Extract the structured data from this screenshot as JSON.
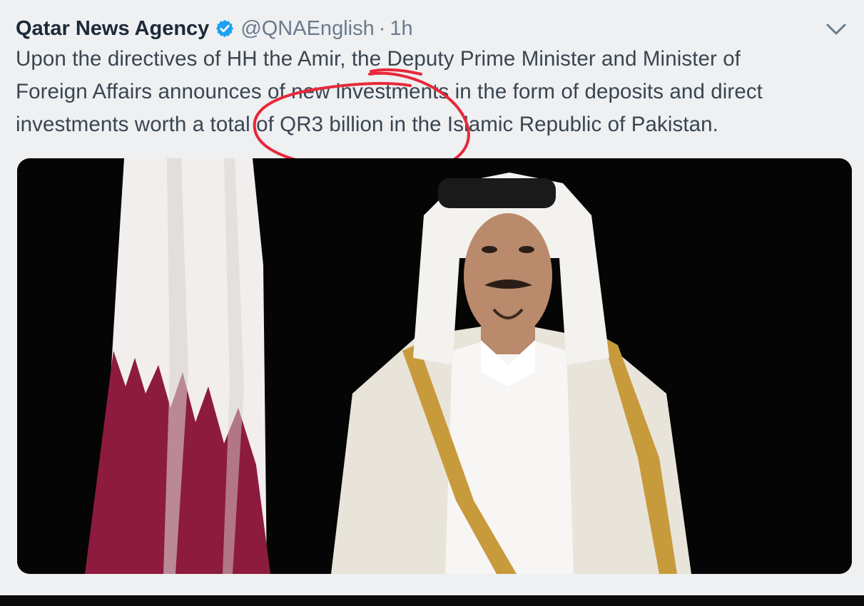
{
  "tweet": {
    "author_name": "Qatar News Agency",
    "handle": "@QNAEnglish",
    "separator": "·",
    "timestamp": "1h",
    "verified_icon": "verified-badge-icon",
    "menu_icon": "chevron-down-icon",
    "text_lines": [
      "Upon the directives of HH the Amir, the Deputy Prime Minister and Minister of",
      "Foreign Affairs announces of new investments in the form of deposits and direct",
      "investments worth a total of QR3 billion in the Islamic Republic of Pakistan."
    ],
    "media": {
      "type": "photo"
    }
  },
  "annotation": {
    "shape": "hand-drawn circle",
    "color": "#e8283a"
  },
  "colors": {
    "page_background": "#eef0f2",
    "name_text": "#1c2938",
    "muted_text": "#6b7b8c",
    "body_text": "#3a4550",
    "verified_blue": "#1da1f2",
    "flag_maroon": "#8d1b3d",
    "photo_background": "#050505"
  }
}
